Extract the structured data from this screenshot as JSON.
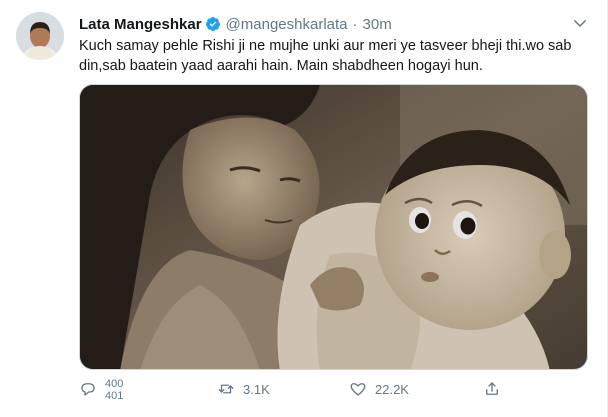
{
  "tweet": {
    "author_name": "Lata Mangeshkar",
    "author_handle": "@mangeshkarlata",
    "separator": "·",
    "time": "30m",
    "text": "Kuch samay pehle Rishi ji ne mujhe unki aur meri ye tasveer bheji thi.wo sab din,sab baatein yaad aarahi hain. Main shabdheen hogayi hun."
  },
  "actions": {
    "reply_count_top": "400",
    "reply_count_bottom": "401",
    "retweet_count": "3.1K",
    "like_count": "22.2K"
  },
  "colors": {
    "link_blue": "#1da1f2",
    "secondary_text": "#657786",
    "primary_text": "#14171a"
  }
}
